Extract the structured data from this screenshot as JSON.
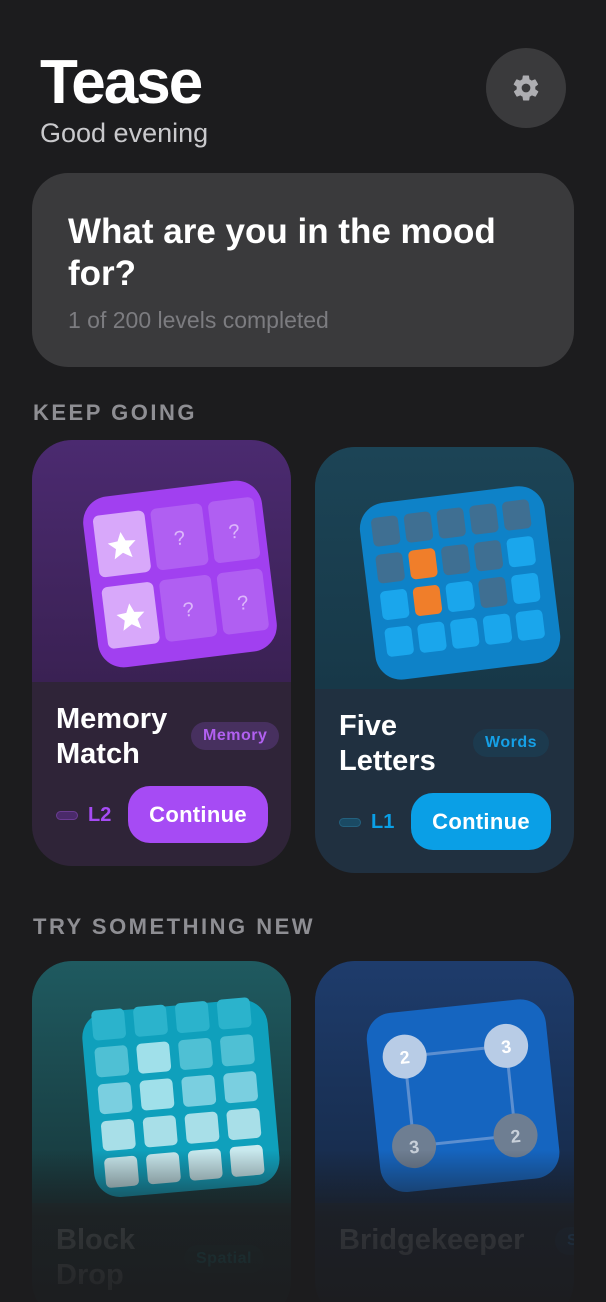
{
  "header": {
    "title": "Tease",
    "greeting": "Good evening"
  },
  "settings": {
    "icon": "gear-icon"
  },
  "mood": {
    "title": "What are you in the mood for?",
    "progress_text": "1 of 200 levels completed",
    "levels_completed": 1,
    "levels_total": 200
  },
  "sections": {
    "keep_going": "KEEP GOING",
    "try_new": "TRY SOMETHING NEW"
  },
  "keep_going": [
    {
      "name_line1": "Memory",
      "name_line2": "Match",
      "tag": "Memory",
      "level": "L2",
      "button": "Continue",
      "accent": "#a64bf4"
    },
    {
      "name_line1": "Five",
      "name_line2": "Letters",
      "tag": "Words",
      "level": "L1",
      "button": "Continue",
      "accent": "#0a9fe6"
    }
  ],
  "try_new": [
    {
      "name_line1": "Block",
      "name_line2": "Drop",
      "tag": "Spatial"
    },
    {
      "name": "Bridgekeeper",
      "tag": "S",
      "islands": [
        "2",
        "3",
        "3",
        "2"
      ]
    }
  ],
  "memory_tiles": [
    "star",
    "?",
    "?",
    "star",
    "?",
    "?"
  ]
}
